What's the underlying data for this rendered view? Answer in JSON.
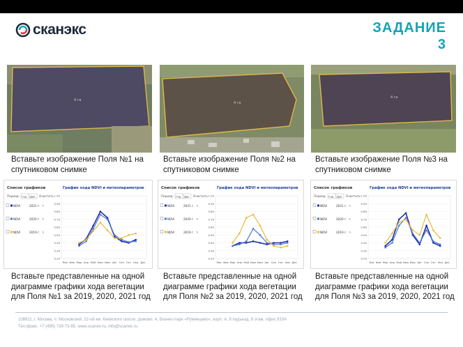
{
  "header": {
    "logo_text": "сканэкс",
    "title_line1": "ЗАДАНИЕ",
    "title_line2": "3"
  },
  "panels": [
    {
      "sat_caption": "Вставьте изображение Поля №1 на спутниковом снимке",
      "chart_caption": "Вставьте представленные на одной диаграмме графики хода вегетации для Поля №1 за 2019, 2020, 2021 год"
    },
    {
      "sat_caption": "Вставьте изображение Поля №2 на спутниковом снимке",
      "chart_caption": "Вставьте представленные на одной диаграмме графики хода вегетации для Поля №2 за 2019, 2020, 2021 год"
    },
    {
      "sat_caption": "Вставьте изображение Поля №3 на спутниковом снимке",
      "chart_caption": "Вставьте представленные на одной диаграмме графики хода вегетации для Поля №3 за 2019, 2020, 2021 год"
    }
  ],
  "chart_widget": {
    "side_title": "Список графиков",
    "chart_title": "График хода NDVI и метеопараметров",
    "period_label": "Период:",
    "period_options": [
      "Год",
      "Дек"
    ],
    "clear_label": "Очистить",
    "series_rows": [
      {
        "label": "NDVI",
        "year": "2021 г.",
        "color": "#1f2fa8"
      },
      {
        "label": "NDVI",
        "year": "2020 г.",
        "color": "#4a78d4"
      },
      {
        "label": "NDVI",
        "year": "2019 г.",
        "color": "#e8b93a"
      }
    ],
    "y_ticks": [
      "1.00",
      "0.90",
      "0.80",
      "0.70",
      "0.60",
      "0.50",
      "0.40",
      "0.30",
      "0.20"
    ],
    "months": [
      "Янв",
      "Фев",
      "Мар",
      "Апр",
      "Май",
      "Июн",
      "Июл",
      "Авг",
      "Сен",
      "Окт",
      "Ноя",
      "Дек"
    ]
  },
  "chart_data": [
    {
      "type": "line",
      "title": "График хода NDVI и метеопараметров",
      "categories": [
        "Янв",
        "Фев",
        "Мар",
        "Апр",
        "Май",
        "Июн",
        "Июл",
        "Авг",
        "Сен",
        "Окт",
        "Ноя",
        "Дек"
      ],
      "ylim": [
        0.2,
        1.0
      ],
      "series": [
        {
          "name": "2021 г.",
          "values": [
            null,
            null,
            0.38,
            0.45,
            0.62,
            0.8,
            0.72,
            0.48,
            0.42,
            0.4,
            0.44,
            null
          ]
        },
        {
          "name": "2020 г.",
          "values": [
            null,
            null,
            0.36,
            0.42,
            0.58,
            0.76,
            0.7,
            0.5,
            0.44,
            0.41,
            0.42,
            null
          ]
        },
        {
          "name": "2019 г.",
          "values": [
            null,
            null,
            0.4,
            0.44,
            0.55,
            0.66,
            0.56,
            0.46,
            0.46,
            0.5,
            0.52,
            null
          ]
        }
      ]
    },
    {
      "type": "line",
      "title": "График хода NDVI и метеопараметров",
      "categories": [
        "Янв",
        "Фев",
        "Мар",
        "Апр",
        "Май",
        "Июн",
        "Июл",
        "Авг",
        "Сен",
        "Окт",
        "Ноя",
        "Дек"
      ],
      "ylim": [
        0.2,
        1.0
      ],
      "series": [
        {
          "name": "2021 г.",
          "values": [
            null,
            null,
            0.36,
            0.4,
            0.4,
            0.42,
            0.4,
            0.38,
            0.4,
            0.4,
            0.42,
            null
          ]
        },
        {
          "name": "2020 г.",
          "values": [
            null,
            null,
            0.36,
            0.38,
            0.42,
            0.58,
            0.5,
            0.4,
            0.38,
            0.38,
            0.4,
            null
          ]
        },
        {
          "name": "2019 г.",
          "values": [
            null,
            null,
            0.4,
            0.52,
            0.72,
            0.76,
            0.62,
            0.44,
            0.36,
            0.34,
            0.36,
            null
          ]
        }
      ]
    },
    {
      "type": "line",
      "title": "График хода NDVI и метеопараметров",
      "categories": [
        "Янв",
        "Фев",
        "Мар",
        "Апр",
        "Май",
        "Июн",
        "Июл",
        "Авг",
        "Сен",
        "Окт",
        "Ноя",
        "Дек"
      ],
      "ylim": [
        0.2,
        1.0
      ],
      "series": [
        {
          "name": "2021 г.",
          "values": [
            null,
            null,
            0.36,
            0.44,
            0.7,
            0.78,
            0.5,
            0.38,
            0.62,
            0.4,
            0.36,
            null
          ]
        },
        {
          "name": "2020 г.",
          "values": [
            null,
            null,
            0.34,
            0.4,
            0.62,
            0.72,
            0.52,
            0.4,
            0.56,
            0.42,
            0.38,
            null
          ]
        },
        {
          "name": "2019 г.",
          "values": [
            null,
            null,
            0.4,
            0.52,
            0.66,
            0.7,
            0.56,
            0.5,
            0.76,
            0.56,
            0.46,
            null
          ]
        }
      ]
    }
  ],
  "footer": {
    "line1": "108811, г. Москва, п. Московский, 22-ой км. Киевского шоссе, домовл. 4, Бизнес-парк «Румянцево», корп. А, 8 подъезд, 8 этаж, офис 819А",
    "line2": "Тел./факс: +7 (495) 739-73-85, www.scanex.ru, info@scanex.ru"
  }
}
